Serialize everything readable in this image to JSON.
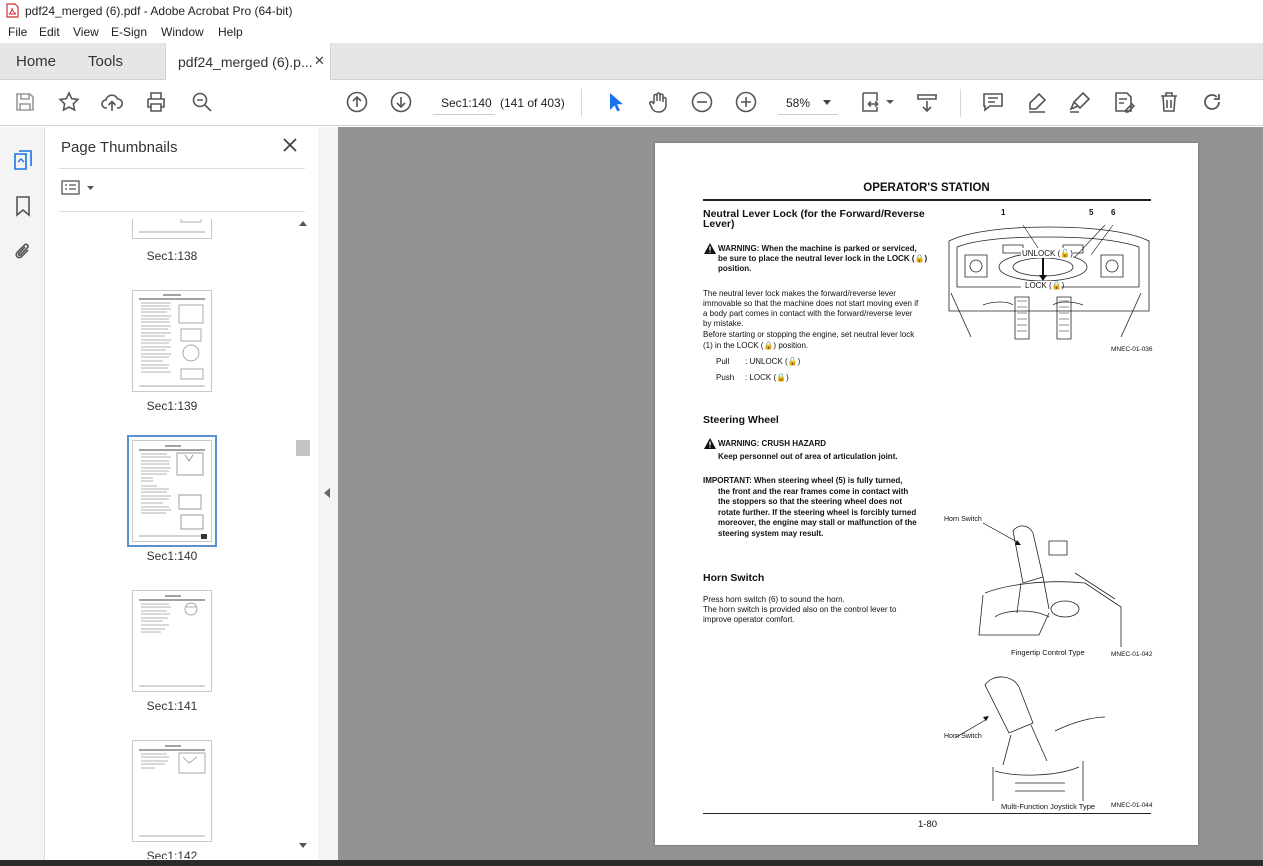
{
  "window": {
    "title": "pdf24_merged (6).pdf - Adobe Acrobat Pro (64-bit)"
  },
  "menu": [
    "File",
    "Edit",
    "View",
    "E-Sign",
    "Window",
    "Help"
  ],
  "tabs": {
    "home": "Home",
    "tools": "Tools",
    "document": "pdf24_merged (6).p...",
    "close_glyph": "✕"
  },
  "toolbar": {
    "page_label": "Sec1:140",
    "page_count": "(141 of 403)",
    "zoom": "58%"
  },
  "panel": {
    "title": "Page Thumbnails",
    "thumbnails": [
      {
        "label": "Sec1:138"
      },
      {
        "label": "Sec1:139"
      },
      {
        "label": "Sec1:140",
        "selected": true
      },
      {
        "label": "Sec1:141"
      },
      {
        "label": "Sec1:142"
      }
    ]
  },
  "document": {
    "section_title": "OPERATOR'S STATION",
    "neutral_lock": {
      "heading_line1": "Neutral Lever Lock (for the Forward/Reverse",
      "heading_line2": "Lever)",
      "warning_line1": "WARNING:   When the machine is parked or serviced,",
      "warning_line2": "be sure to place the neutral lever lock in the LOCK (🔒)",
      "warning_line3": "position.",
      "body_line1": "The neutral lever lock makes the forward/reverse lever",
      "body_line2": "immovable so that the machine does not start moving even if",
      "body_line3": "a body part comes in contact with the forward/reverse lever",
      "body_line4": "by mistake.",
      "body_line5": "Before starting or stopping the engine, set neutral lever lock",
      "body_line6": "(1) in the LOCK (🔒) position.",
      "pull_label": "Pull",
      "pull_value": ": UNLOCK (🔓)",
      "push_label": "Push",
      "push_value": ": LOCK (🔒)",
      "fig_unlock": "UNLOCK (🔓)",
      "fig_lock": "LOCK (🔒)",
      "fig_callout_1": "1",
      "fig_callout_5": "5",
      "fig_callout_6": "6",
      "fig_code": "MNEC-01-036"
    },
    "steering": {
      "heading": "Steering Wheel",
      "warning_line1": "WARNING:   CRUSH HAZARD",
      "warning_line2": "Keep personnel out of area of articulation joint.",
      "important_line1": "IMPORTANT:    When steering wheel (5) is fully turned,",
      "important_line2": "the front and the rear frames come in contact with",
      "important_line3": "the stoppers so that the steering wheel does not",
      "important_line4": "rotate further. If the steering wheel is forcibly turned",
      "important_line5": "moreover, the engine may stall or malfunction of the",
      "important_line6": "steering system may result."
    },
    "horn": {
      "heading": "Horn Switch",
      "body_line1": "Press horn switch (6) to sound the horn.",
      "body_line2": "The horn switch is provided also on the control lever to",
      "body_line3": "improve operator comfort.",
      "fig1_label": "Horn Switch",
      "fig1_caption": "Fingertip Control Type",
      "fig1_code": "MNEC-01-042",
      "fig2_label": "Horn Switch",
      "fig2_caption": "Multi-Function Joystick Type",
      "fig2_code": "MNEC-01-044"
    },
    "page_number": "1-80"
  }
}
